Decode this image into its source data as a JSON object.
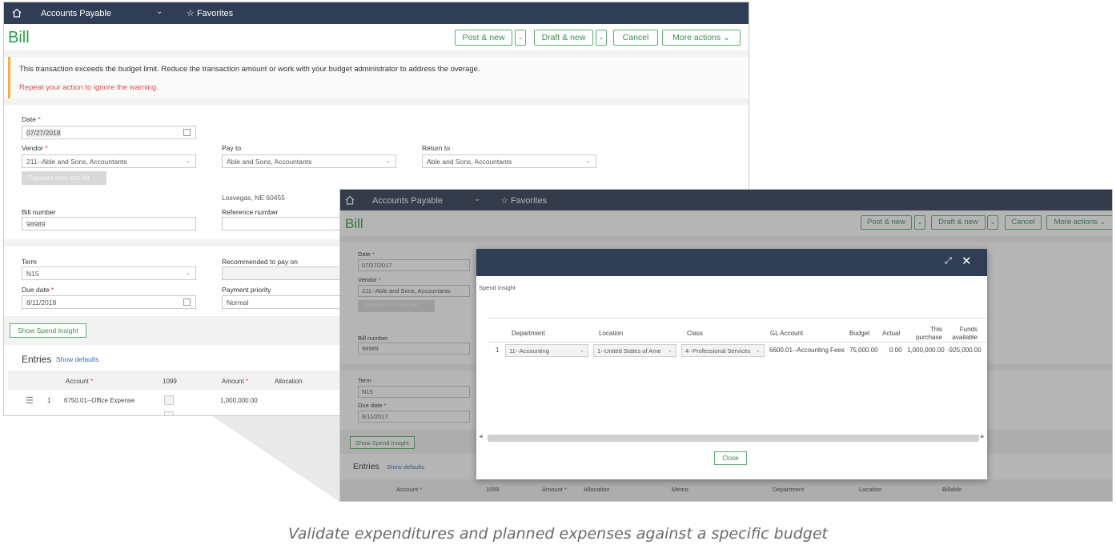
{
  "back": {
    "topbar": {
      "app": "Accounts Payable",
      "favorites": "Favorites"
    },
    "title": "Bill",
    "actions": {
      "post_new": "Post & new",
      "draft_new": "Draft & new",
      "cancel": "Cancel",
      "more": "More actions"
    },
    "warning": {
      "message": "This transaction exceeds the budget limit. Reduce the transaction amount or work with your budget administrator to address the overage.",
      "repeat": "Repeat your action to ignore the warning."
    },
    "form": {
      "date_label": "Date",
      "date_value": "07/27/2018",
      "vendor_label": "Vendor",
      "vendor_value": "211--Able and Sons, Accountants",
      "populate_btn": "Populate from last bill",
      "pay_to_label": "Pay to",
      "pay_to_value": "Able and Sons, Accountants",
      "return_to_label": "Return to",
      "return_to_value": "Able and Sons, Accountants",
      "address": "Losvegas, NE 60455",
      "bill_number_label": "Bill number",
      "bill_number_value": "98989",
      "reference_label": "Reference number",
      "term_label": "Term",
      "term_value": "N15",
      "recommended_label": "Recommended to pay on",
      "due_date_label": "Due date",
      "due_date_value": "8/11/2018",
      "priority_label": "Payment priority",
      "priority_value": "Normal"
    },
    "spend_insight_btn": "Show Spend Insight",
    "entries": {
      "title": "Entries",
      "show_defaults": "Show defaults",
      "col_account": "Account",
      "col_1099": "1099",
      "col_amount": "Amount",
      "col_allocation": "Allocation",
      "row_num": "1",
      "row_account": "6750.01--Office Expense",
      "row_amount": "1,000,000.00"
    }
  },
  "front": {
    "topbar": {
      "app": "Accounts Payable",
      "favorites": "Favorites"
    },
    "title": "Bill",
    "actions": {
      "post_new": "Post & new",
      "draft_new": "Draft & new",
      "cancel": "Cancel",
      "more": "More actions"
    },
    "form": {
      "date_label": "Date",
      "date_value": "07/27/2017",
      "vendor_label": "Vendor",
      "vendor_value": "211--Able and Sons, Accountants",
      "populate_btn": "Populate from last bill",
      "bill_number_label": "Bill number",
      "bill_number_value": "98989",
      "term_label": "Term",
      "term_value": "N15",
      "due_date_label": "Due date",
      "due_date_value": "8/11/2017"
    },
    "spend_insight_btn": "Show Spend Insight",
    "entries": {
      "title": "Entries",
      "show_defaults": "Show defaults",
      "cols": [
        "Account",
        "1099",
        "Amount",
        "Allocation",
        "Memo",
        "Department",
        "Location",
        "Billable"
      ]
    },
    "modal": {
      "title": "Spend Insight",
      "headers": {
        "department": "Department",
        "location": "Location",
        "class": "Class",
        "gl_account": "GL Account",
        "budget": "Budget",
        "actual": "Actual",
        "this_purchase": "This purchase",
        "funds_available": "Funds available"
      },
      "row": {
        "num": "1",
        "department": "11--Accounting",
        "location": "1--United States of Ame",
        "class": "4--Professional Services",
        "gl_account": "6600.01--Accounting Fees",
        "budget": "75,000.00",
        "actual": "0.00",
        "this_purchase": "1,000,000.00",
        "funds_available": "-925,000.00"
      },
      "close": "Close"
    }
  },
  "caption": "Validate expenditures and planned expenses against a specific budget",
  "colors": {
    "navy": "#2f3d55",
    "green": "#2e9a46",
    "warning_red": "#d9534f",
    "link": "#2d6fb3"
  }
}
